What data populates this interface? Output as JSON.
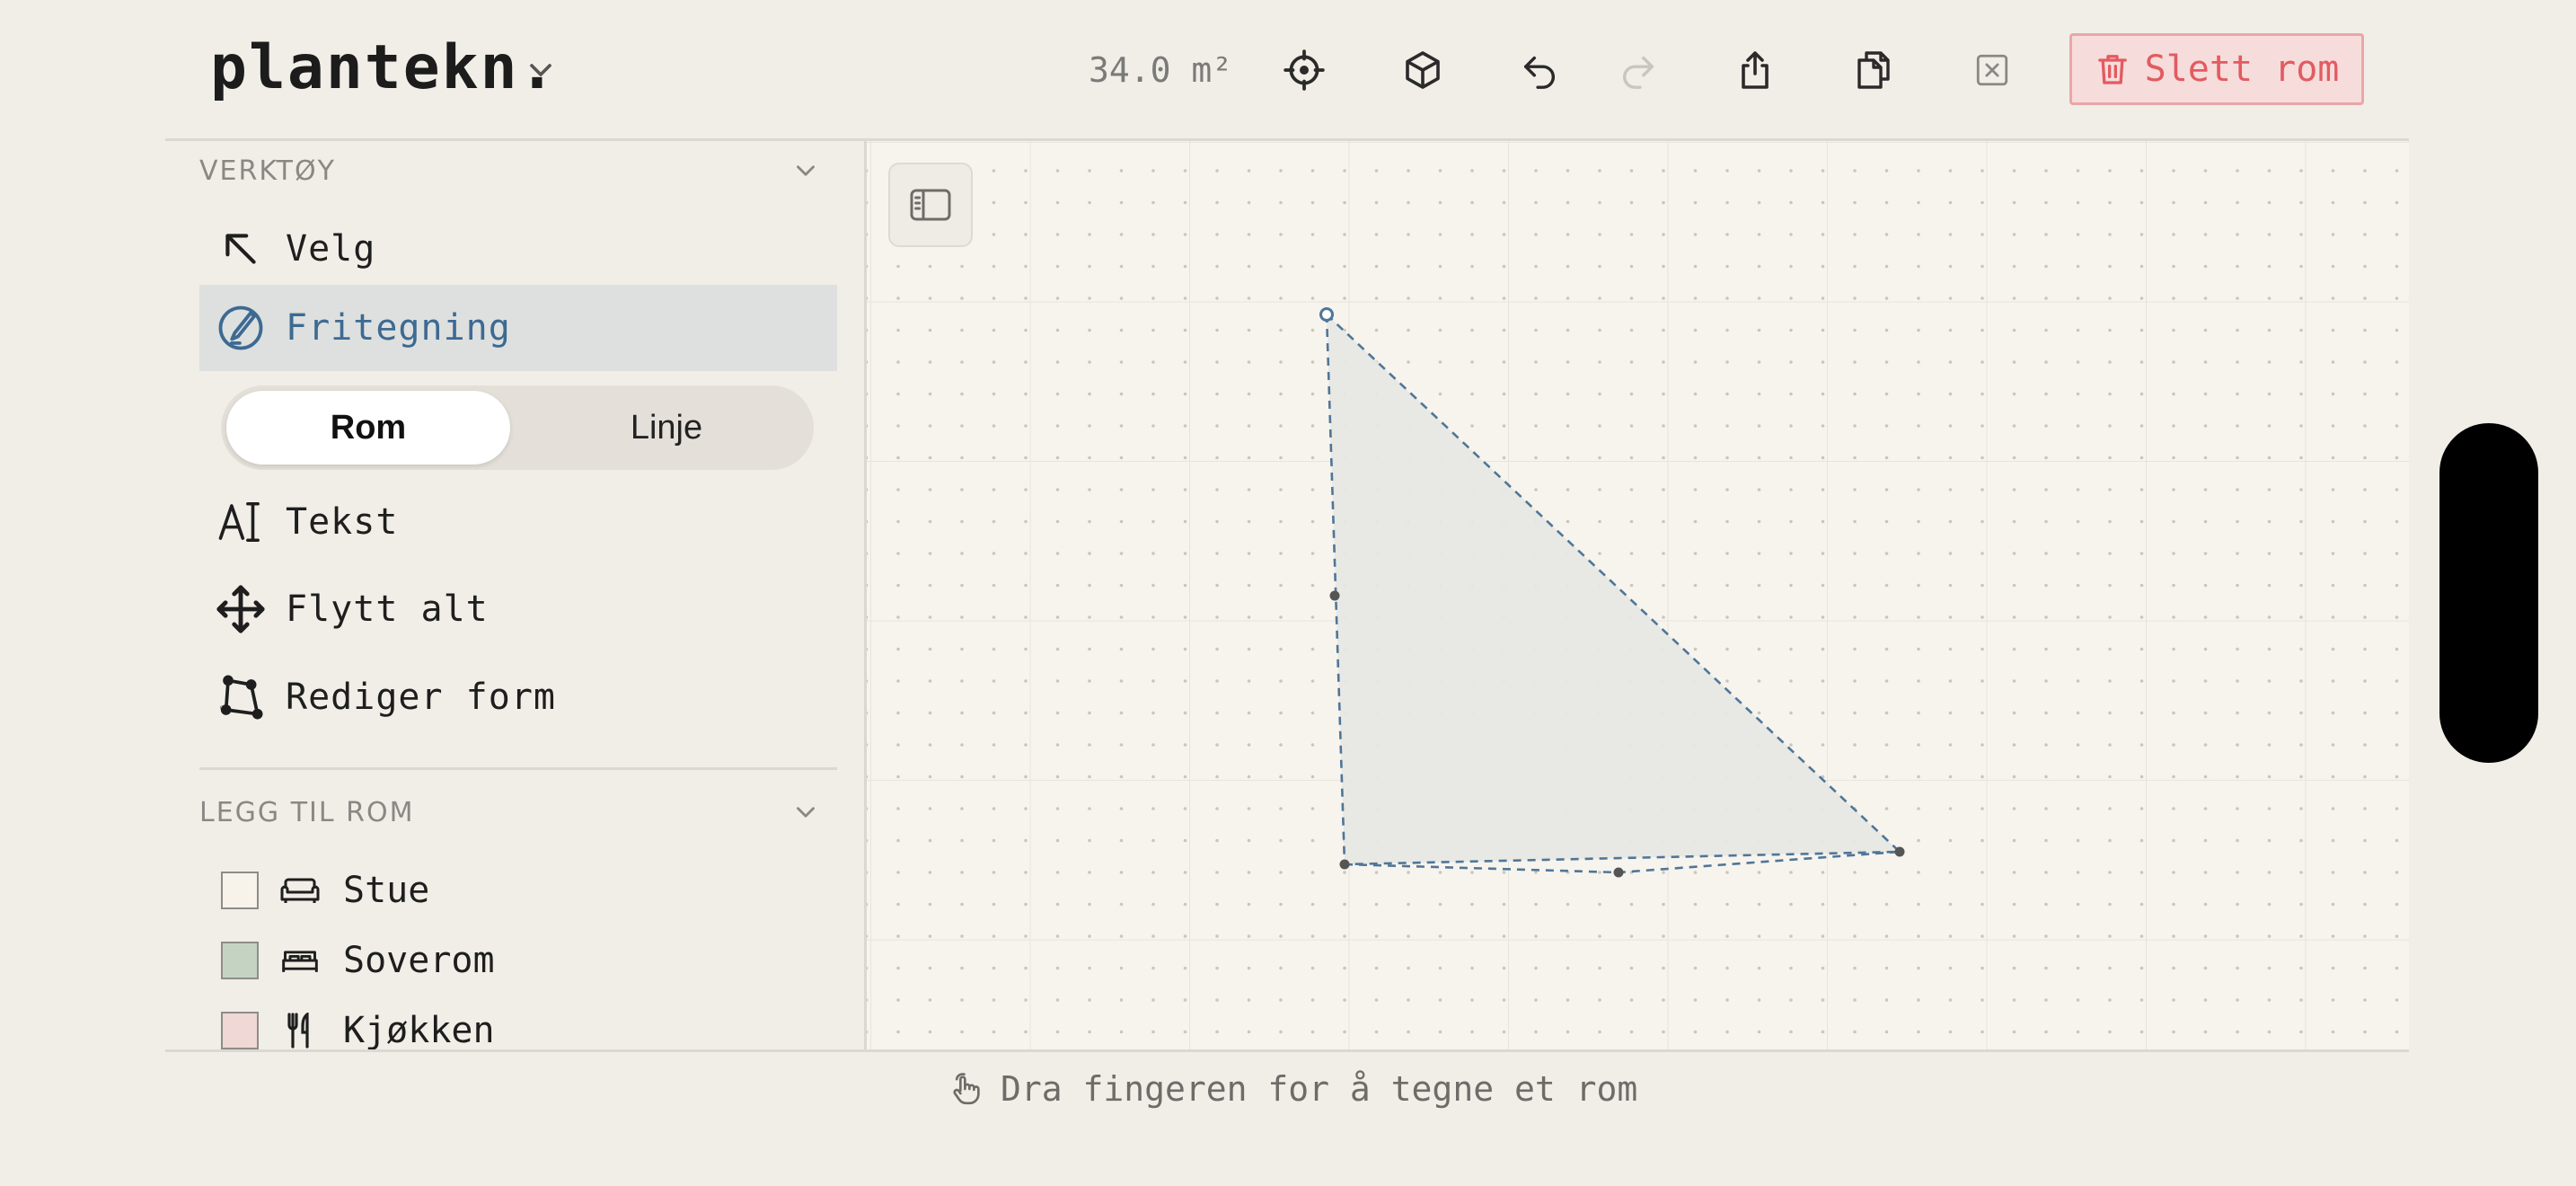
{
  "header": {
    "app_title": "plantekn.",
    "area_readout": "34.0 m²",
    "delete_label": "Slett rom",
    "icons": [
      "target-icon",
      "cube-icon",
      "undo-icon",
      "redo-icon",
      "share-icon",
      "copy-icon",
      "close-icon",
      "trash-icon"
    ]
  },
  "sidebar": {
    "tools_header": "VERKTØY",
    "tools": [
      {
        "label": "Velg",
        "icon": "arrow-select-icon"
      },
      {
        "label": "Fritegning",
        "icon": "freehand-pen-icon",
        "active": true
      },
      {
        "label": "Tekst",
        "icon": "text-cursor-icon"
      },
      {
        "label": "Flytt alt",
        "icon": "move-arrows-icon"
      },
      {
        "label": "Rediger form",
        "icon": "edit-shape-icon"
      }
    ],
    "draw_mode": {
      "options": [
        "Rom",
        "Linje"
      ],
      "selected": "Rom"
    },
    "rooms_header": "LEGG TIL ROM",
    "rooms": [
      {
        "label": "Stue",
        "icon": "sofa-icon",
        "color": "#f7f3ea"
      },
      {
        "label": "Soverom",
        "icon": "bed-icon",
        "color": "#c5d4c2"
      },
      {
        "label": "Kjøkken",
        "icon": "utensils-icon",
        "color": "#efd8d6"
      }
    ]
  },
  "canvas": {
    "hint": "Dra fingeren for å tegne et rom",
    "room_fill": "#e7e7e3",
    "room_stroke": "#4f7697"
  },
  "colors": {
    "accent": "#3d6a93",
    "danger": "#e25b60",
    "active_tool_bg": "#dde0de"
  }
}
